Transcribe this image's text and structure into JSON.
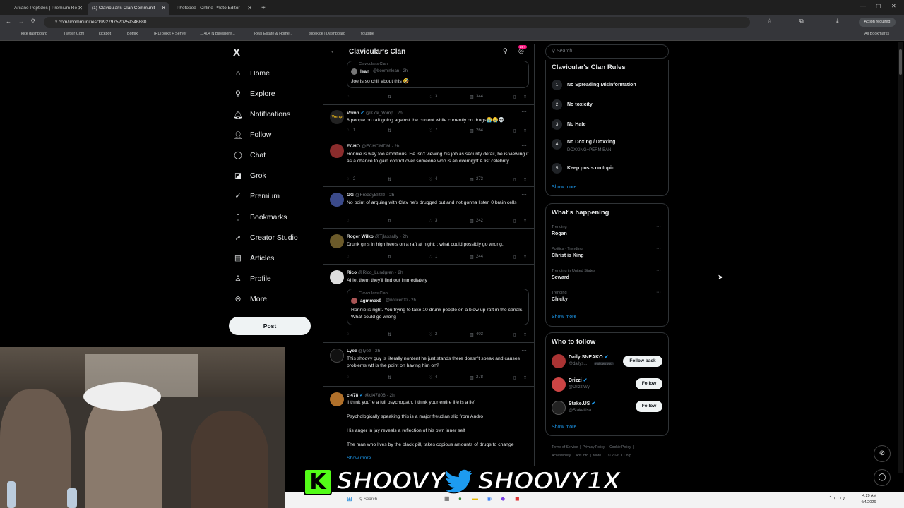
{
  "browser": {
    "tabs": [
      {
        "title": "Arcane Peptides | Premium Re"
      },
      {
        "title": "(1) Clavicular's Clan Communit"
      },
      {
        "title": "Photopea | Online Photo Editor"
      }
    ],
    "url": "x.com/i/communities/1992797520259346880",
    "action_required": "Action required",
    "bookmarks": [
      "kick dashboard",
      "Twitter Com",
      "kickbot",
      "Botflix",
      "IRLToolkit + Server",
      "11404 N Bayshore...",
      "Real Estate & Home...",
      "sidekick | Dashboard",
      "Youtube"
    ],
    "all_bookmarks": "All Bookmarks"
  },
  "nav": {
    "logo": "X",
    "items": [
      "Home",
      "Explore",
      "Notifications",
      "Follow",
      "Chat",
      "Grok",
      "Premium",
      "Bookmarks",
      "Creator Studio",
      "Articles",
      "Profile",
      "More"
    ],
    "post_label": "Post"
  },
  "header": {
    "title": "Clavicular's Clan",
    "badge": "20+"
  },
  "tweets": [
    {
      "community": "Clavicular's Clan",
      "name": "lean",
      "handle": "@boominlean · 2h",
      "text": "Joe is so chill about this 🤣",
      "likes": "3",
      "views": "344"
    },
    {
      "name": "Vomp",
      "handle": "@Kick_Vomp · 2h",
      "text": "8 people on raft going against the current while currently on drugs😭😭💀",
      "replies": "1",
      "likes": "7",
      "views": "264"
    },
    {
      "name": "ECHO",
      "handle": "@ECHOMDM · 2h",
      "text": "Ronnie is way too ambitious. He isn't viewing his job as security detail, he is viewing it as a chance to gain control over someone who is an overnight A list celebrity.",
      "replies": "2",
      "likes": "4",
      "views": "273"
    },
    {
      "name": "GG",
      "handle": "@FreddyBlitzz · 2h",
      "text": "No point of arguing with Clav he's drugged out and not gonna listen 0 brain cells",
      "likes": "3",
      "views": "242"
    },
    {
      "name": "Roger Wilko",
      "handle": "@Tjlassally · 2h",
      "text": "Drunk girls in high heels on a raft at night::: what could possibly go wrong,",
      "likes": "1",
      "views": "244"
    },
    {
      "name": "Rico",
      "handle": "@Rico_Lundgren · 2h",
      "text": "AI let them they'll find out immediately",
      "quote_community": "Clavicular's Clan",
      "quote_name": "agmmax9",
      "quote_handle": "@noticer00 · 2h",
      "quote_text": "Ronnie is right. You trying to take 10 drunk people on a blow up raft in the canals. What could go wrong",
      "likes": "2",
      "views": "403"
    },
    {
      "name": "Lyez",
      "handle": "@lyez · 2h",
      "text": "This shoovy guy is literally nontent he just stands there doesn't speak and causes problems wtf is the point on having him on?",
      "likes": "4",
      "views": "278"
    },
    {
      "name": "cl478",
      "handle": "@cl47806 · 2h",
      "paragraphs": [
        "'I think you're a full psychopath, I think your entire life is a lie'",
        "Psychologically speaking this is a major freudian slip from Andro",
        "His anger in jay reveals a reflection of his own inner self",
        "The man who lives by the black pill, takes copious amounts of drugs to change"
      ],
      "show_more": "Show more"
    }
  ],
  "search": {
    "placeholder": "Search"
  },
  "rules": {
    "title": "Clavicular's Clan Rules",
    "items": [
      {
        "n": "1",
        "text": "No Spreading Misinformation"
      },
      {
        "n": "2",
        "text": "No toxicity"
      },
      {
        "n": "3",
        "text": "No Hate"
      },
      {
        "n": "4",
        "text": "No Doxing / Doxxing",
        "sub": "DOXXING=PERM BAN"
      },
      {
        "n": "5",
        "text": "Keep posts on topic"
      }
    ],
    "show_more": "Show more"
  },
  "happening": {
    "title": "What's happening",
    "items": [
      {
        "context": "Trending",
        "topic": "Rogan"
      },
      {
        "context": "Politics · Trending",
        "topic": "Christ is King"
      },
      {
        "context": "Trending in United States",
        "topic": "Seward"
      },
      {
        "context": "Trending",
        "topic": "Chicky"
      }
    ],
    "show_more": "Show more"
  },
  "who_to_follow": {
    "title": "Who to follow",
    "items": [
      {
        "name": "Daily SNEAKO",
        "handle": "@dailys...",
        "badge": "Follows you",
        "button": "Follow back"
      },
      {
        "name": "Drizzi",
        "handle": "@DrizziWy",
        "button": "Follow"
      },
      {
        "name": "Stake.US",
        "handle": "@StakeUsa",
        "button": "Follow"
      }
    ],
    "show_more": "Show more"
  },
  "footer": [
    "Terms of Service",
    "Privacy Policy",
    "Cookie Policy",
    "Accessibility",
    "Ads info",
    "More ...",
    "© 2026 X Corp."
  ],
  "overlay": {
    "kick_name": "SHOOVY",
    "twitter_name": "SHOOVY1X"
  },
  "taskbar": {
    "time": "4:29 AM",
    "date": "4/4/2026"
  },
  "colors": {
    "accent": "#1d9bf0",
    "kick_green": "#53fc18",
    "twitter_blue": "#1d9bf0"
  }
}
